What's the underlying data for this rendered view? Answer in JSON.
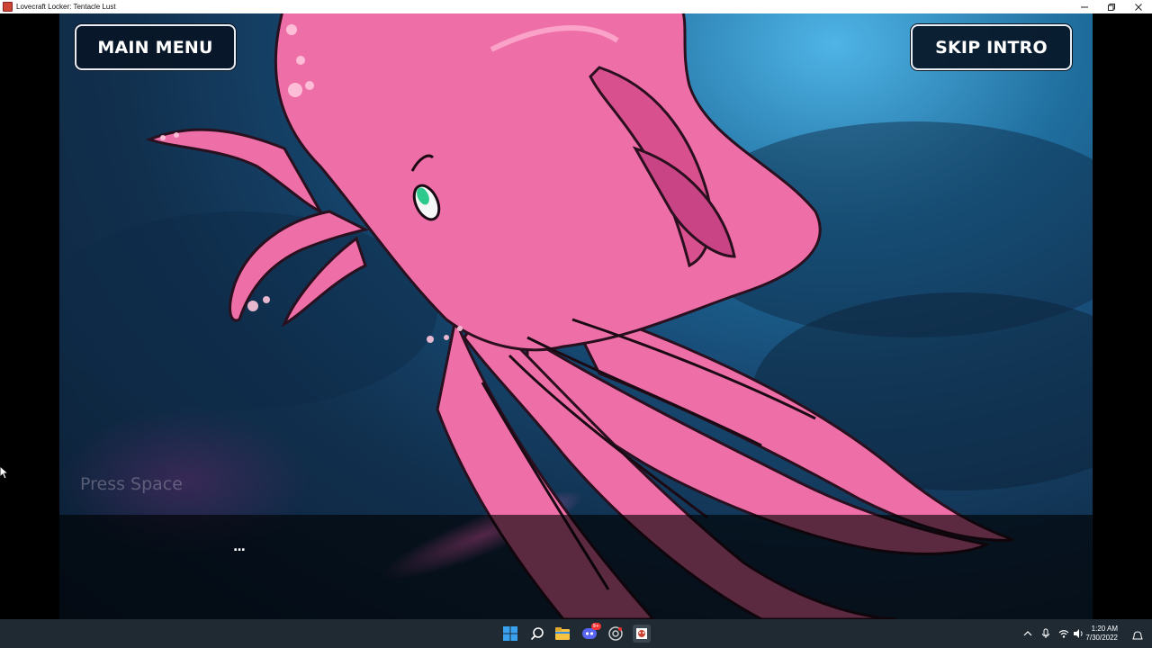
{
  "window": {
    "title": "Lovecraft Locker: Tentacle Lust"
  },
  "game": {
    "main_menu_label": "MAIN MENU",
    "skip_intro_label": "SKIP INTRO",
    "prompt": "Press Space",
    "dialog_text": "..."
  },
  "taskbar": {
    "time": "1:20 AM",
    "date": "7/30/2022",
    "discord_badge": "9+",
    "icons": [
      "windows-start-icon",
      "search-icon",
      "file-explorer-icon",
      "discord-icon",
      "chrome-icon",
      "game-app-icon"
    ]
  },
  "colors": {
    "tentacle_pink": "#ee6fa8",
    "deep_sea": "#123352",
    "taskbar": "#1f2a33"
  }
}
